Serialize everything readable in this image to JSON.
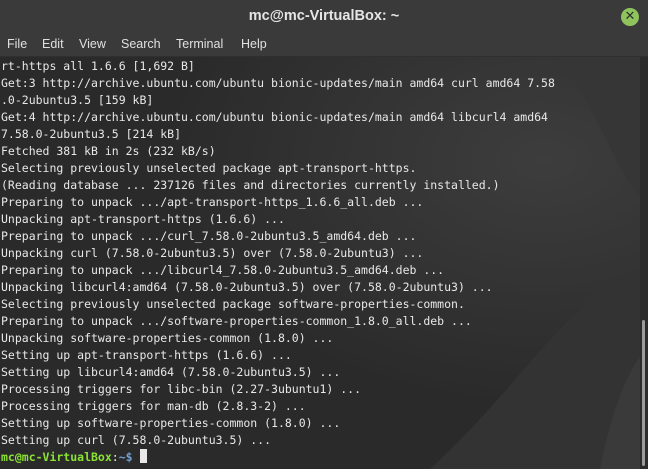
{
  "window": {
    "title": "mc@mc-VirtualBox: ~",
    "close_glyph": "✕"
  },
  "menu": {
    "file": "File",
    "edit": "Edit",
    "view": "View",
    "search": "Search",
    "terminal": "Terminal",
    "help": "Help"
  },
  "terminal": {
    "lines": [
      "rt-https all 1.6.6 [1,692 B]",
      "Get:3 http://archive.ubuntu.com/ubuntu bionic-updates/main amd64 curl amd64 7.58",
      ".0-2ubuntu3.5 [159 kB]",
      "Get:4 http://archive.ubuntu.com/ubuntu bionic-updates/main amd64 libcurl4 amd64",
      "7.58.0-2ubuntu3.5 [214 kB]",
      "Fetched 381 kB in 2s (232 kB/s)",
      "Selecting previously unselected package apt-transport-https.",
      "(Reading database ... 237126 files and directories currently installed.)",
      "Preparing to unpack .../apt-transport-https_1.6.6_all.deb ...",
      "Unpacking apt-transport-https (1.6.6) ...",
      "Preparing to unpack .../curl_7.58.0-2ubuntu3.5_amd64.deb ...",
      "Unpacking curl (7.58.0-2ubuntu3.5) over (7.58.0-2ubuntu3) ...",
      "Preparing to unpack .../libcurl4_7.58.0-2ubuntu3.5_amd64.deb ...",
      "Unpacking libcurl4:amd64 (7.58.0-2ubuntu3.5) over (7.58.0-2ubuntu3) ...",
      "Selecting previously unselected package software-properties-common.",
      "Preparing to unpack .../software-properties-common_1.8.0_all.deb ...",
      "Unpacking software-properties-common (1.8.0) ...",
      "Setting up apt-transport-https (1.6.6) ...",
      "Setting up libcurl4:amd64 (7.58.0-2ubuntu3.5) ...",
      "Processing triggers for libc-bin (2.27-3ubuntu1) ...",
      "Processing triggers for man-db (2.8.3-2) ...",
      "Setting up software-properties-common (1.8.0) ...",
      "Setting up curl (7.58.0-2ubuntu3.5) ..."
    ],
    "prompt_user": "mc@mc-VirtualBox",
    "prompt_sep": ":",
    "prompt_path": "~$",
    "command": " "
  },
  "colors": {
    "prompt_user": "#8ae234",
    "prompt_path": "#729fcf",
    "close_button": "#8fc45c",
    "text": "#e8e8e8"
  }
}
